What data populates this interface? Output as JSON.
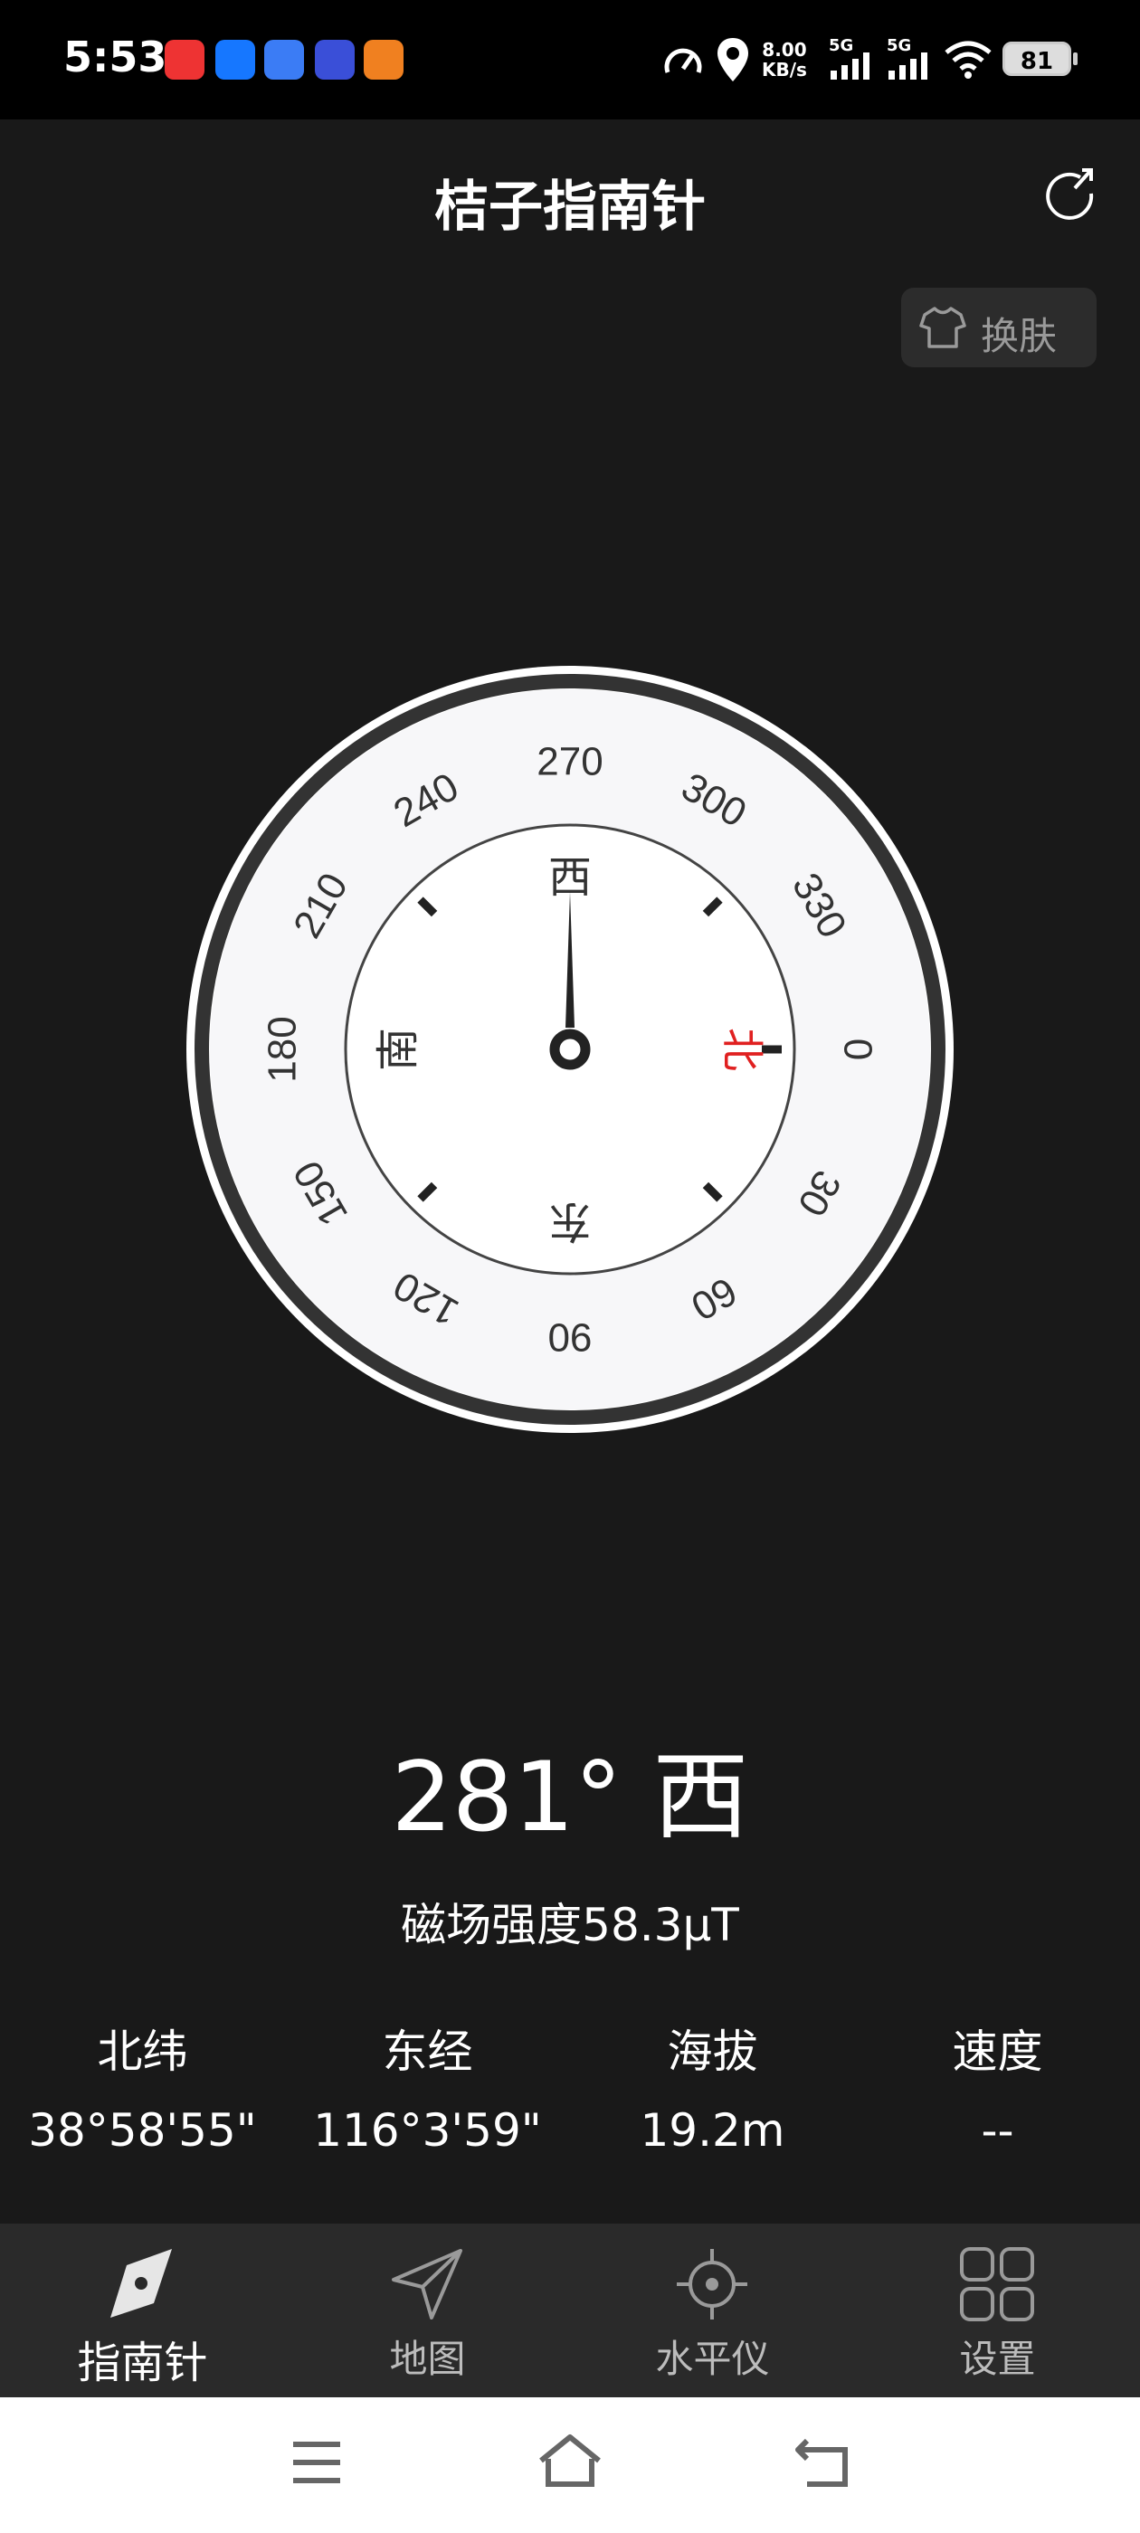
{
  "status_bar": {
    "time": "5:53",
    "net_speed_value": "8.00",
    "net_speed_unit": "KB/s",
    "signal1": "5G",
    "signal2": "5G",
    "battery": "81"
  },
  "header": {
    "title": "桔子指南针",
    "skin_label": "换肤",
    "refresh_icon": "refresh-icon",
    "shirt_icon": "shirt-icon"
  },
  "compass": {
    "dial_numbers": [
      "0",
      "30",
      "60",
      "90",
      "120",
      "150",
      "180",
      "210",
      "240",
      "270",
      "300",
      "330"
    ],
    "dial_cardinals": {
      "north": "北",
      "east": "东",
      "south": "南",
      "west": "西"
    },
    "north_color": "#e02020",
    "needle_color": "#222222"
  },
  "readout": {
    "heading": "281° 西",
    "magnetic": "磁场强度58.3μT"
  },
  "info": [
    {
      "label": "北纬",
      "value": "38°58'55\""
    },
    {
      "label": "东经",
      "value": "116°3'59\""
    },
    {
      "label": "海拔",
      "value": "19.2m"
    },
    {
      "label": "速度",
      "value": "--"
    }
  ],
  "nav": [
    {
      "label": "指南针",
      "icon": "compass-icon",
      "active": true
    },
    {
      "label": "地图",
      "icon": "location-arrow-icon",
      "active": false
    },
    {
      "label": "水平仪",
      "icon": "crosshair-icon",
      "active": false
    },
    {
      "label": "设置",
      "icon": "grid-icon",
      "active": false
    }
  ],
  "colors": {
    "background": "#191919",
    "status_bar": "#000000",
    "nav_bar": "#2a2a2a"
  }
}
